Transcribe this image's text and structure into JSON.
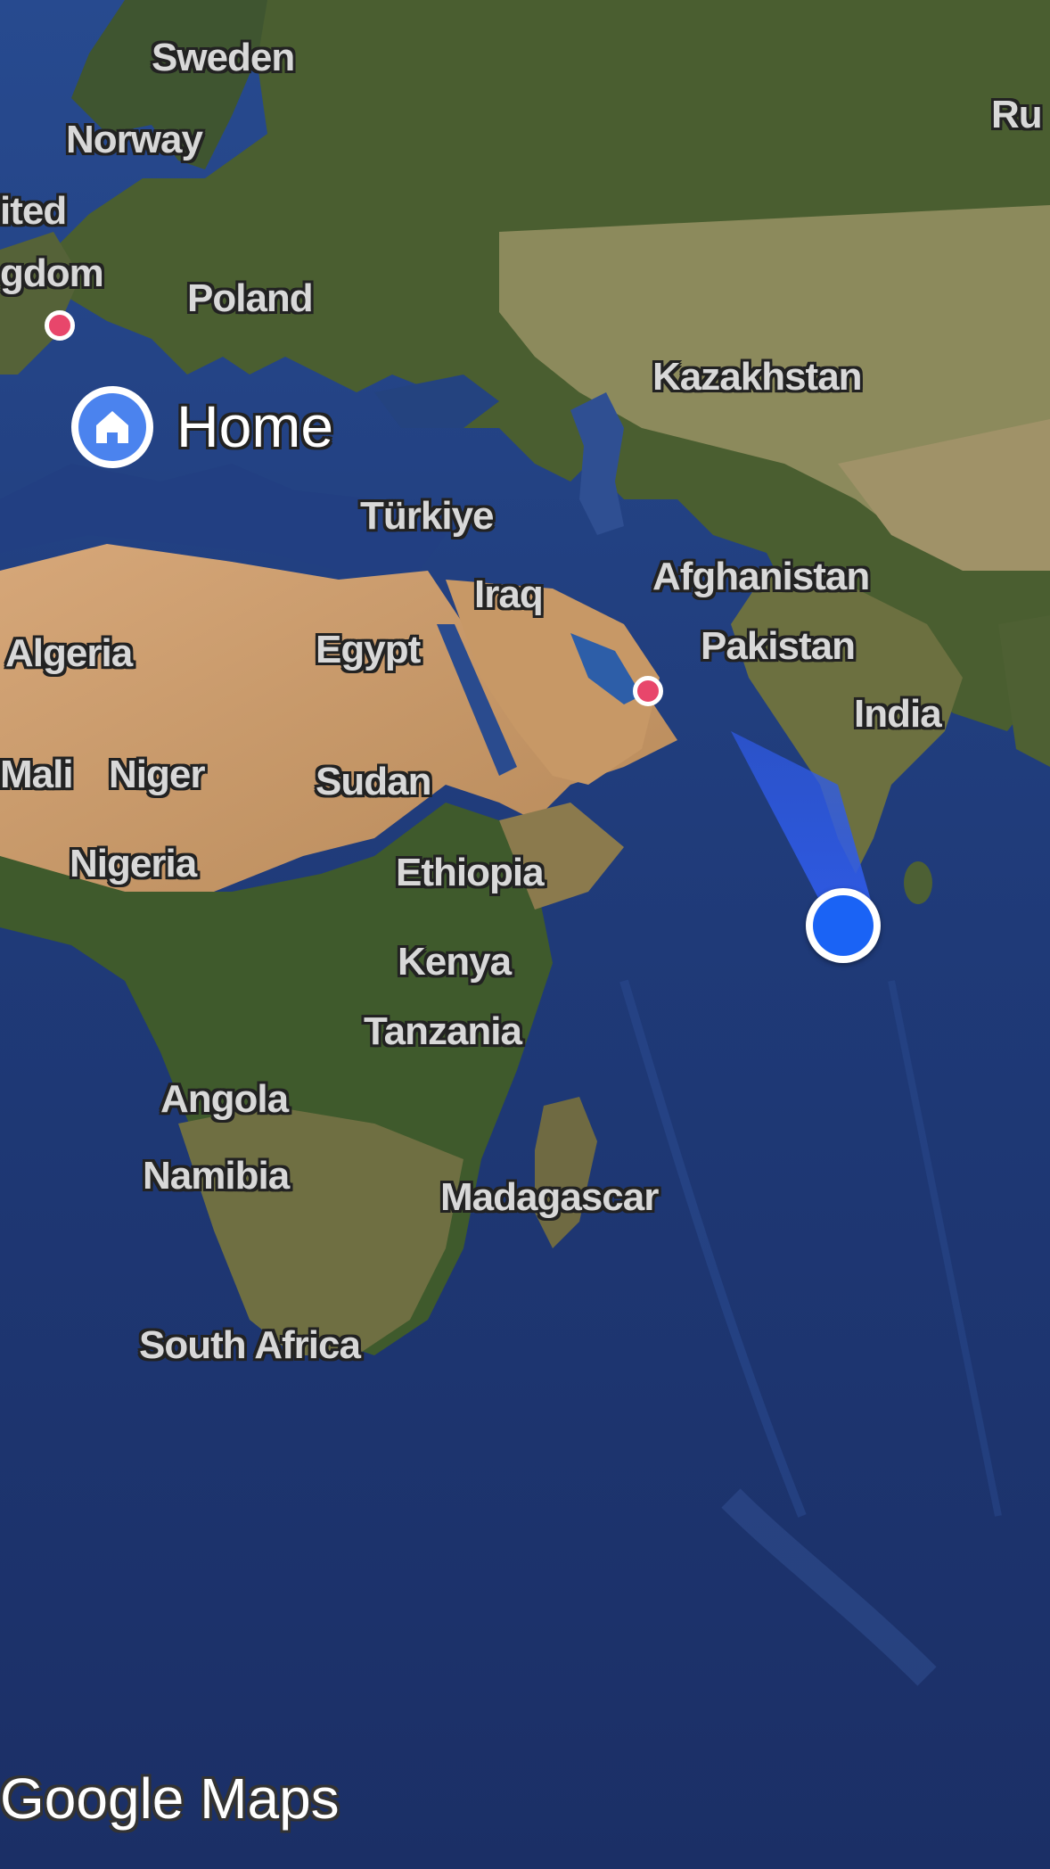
{
  "map": {
    "type": "satellite",
    "colors": {
      "ocean": "#1f3a78",
      "land_green": "#4a5e30",
      "desert": "#c99a6a",
      "steppe": "#8c8a5c",
      "pin_home": "#4b83ee",
      "my_location": "#1a63f5",
      "place_marker": "#e8466b"
    },
    "labels": [
      {
        "id": "sweden",
        "text": "Sweden"
      },
      {
        "id": "norway",
        "text": "Norway"
      },
      {
        "id": "united",
        "text": "ited"
      },
      {
        "id": "kingdom",
        "text": "gdom"
      },
      {
        "id": "poland",
        "text": "Poland"
      },
      {
        "id": "russia",
        "text": "Ru"
      },
      {
        "id": "kazakhstan",
        "text": "Kazakhstan"
      },
      {
        "id": "turkiye",
        "text": "Türkiye"
      },
      {
        "id": "iraq",
        "text": "Iraq"
      },
      {
        "id": "afghanistan",
        "text": "Afghanistan"
      },
      {
        "id": "pakistan",
        "text": "Pakistan"
      },
      {
        "id": "india",
        "text": "India"
      },
      {
        "id": "algeria",
        "text": "Algeria"
      },
      {
        "id": "egypt",
        "text": "Egypt"
      },
      {
        "id": "mali",
        "text": "Mali"
      },
      {
        "id": "niger",
        "text": "Niger"
      },
      {
        "id": "sudan",
        "text": "Sudan"
      },
      {
        "id": "nigeria",
        "text": "Nigeria"
      },
      {
        "id": "ethiopia",
        "text": "Ethiopia"
      },
      {
        "id": "kenya",
        "text": "Kenya"
      },
      {
        "id": "tanzania",
        "text": "Tanzania"
      },
      {
        "id": "angola",
        "text": "Angola"
      },
      {
        "id": "namibia",
        "text": "Namibia"
      },
      {
        "id": "madagascar",
        "text": "Madagascar"
      },
      {
        "id": "south_africa",
        "text": "South Africa"
      }
    ],
    "home": {
      "label": "Home",
      "icon": "home-icon"
    },
    "watermark": "Google Maps"
  }
}
